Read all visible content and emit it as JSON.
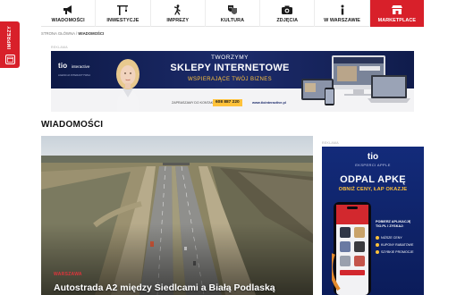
{
  "nav": {
    "items": [
      {
        "label": "WIADOMOŚCI",
        "icon": "megaphone-icon"
      },
      {
        "label": "INWESTYCJE",
        "icon": "crane-icon"
      },
      {
        "label": "IMPREZY",
        "icon": "dancing-person-icon"
      },
      {
        "label": "KULTURA",
        "icon": "theater-masks-icon"
      },
      {
        "label": "ZDJĘCIA",
        "icon": "camera-icon"
      },
      {
        "label": "W WARSZAWIE",
        "icon": "info-icon"
      },
      {
        "label": "MARKETPLACE",
        "icon": "shop-icon"
      }
    ],
    "active_color": "#d8202a"
  },
  "side_tab": {
    "label": "IMPREZY",
    "icon": "calendar-icon"
  },
  "breadcrumb": {
    "home": "STRONA GŁÓWNA",
    "separator": " / ",
    "current": "WIADOMOŚCI"
  },
  "ads": {
    "label": "REKLAMA"
  },
  "top_banner": {
    "logo": "tio",
    "logo_suffix": "interactive",
    "logo_tagline": "AGENCJA INTERAKTYWNA",
    "line1": "TWORZYMY",
    "line2": "SKLEPY INTERNETOWE",
    "line3": "WSPIERAJĄCE TWÓJ BIZNES",
    "contact_label": "ZAPRASZAMY DO KONTAKTU",
    "phone": "608 887 220",
    "url": "www.tiointeractive.pl"
  },
  "section": {
    "title": "WIADOMOŚCI"
  },
  "hero": {
    "category": "WARSZAWA",
    "title": "Autostrada A2 między Siedlcami a Białą Podlaską"
  },
  "side_ad": {
    "logo": "tio",
    "logo_sub": "EKSPERCI APPLE",
    "headline": "ODPAL APKĘ",
    "subline": "OBNIŻ CENY, ŁAP OKAZJE",
    "copy": "POBIERZ APLIKACJĘ TIO.PL I ZYSKAJ:",
    "benefits": [
      "NIŻSZE CENY",
      "KUPONY RABATOWE",
      "SZYBKIE PROMOCJE"
    ]
  }
}
